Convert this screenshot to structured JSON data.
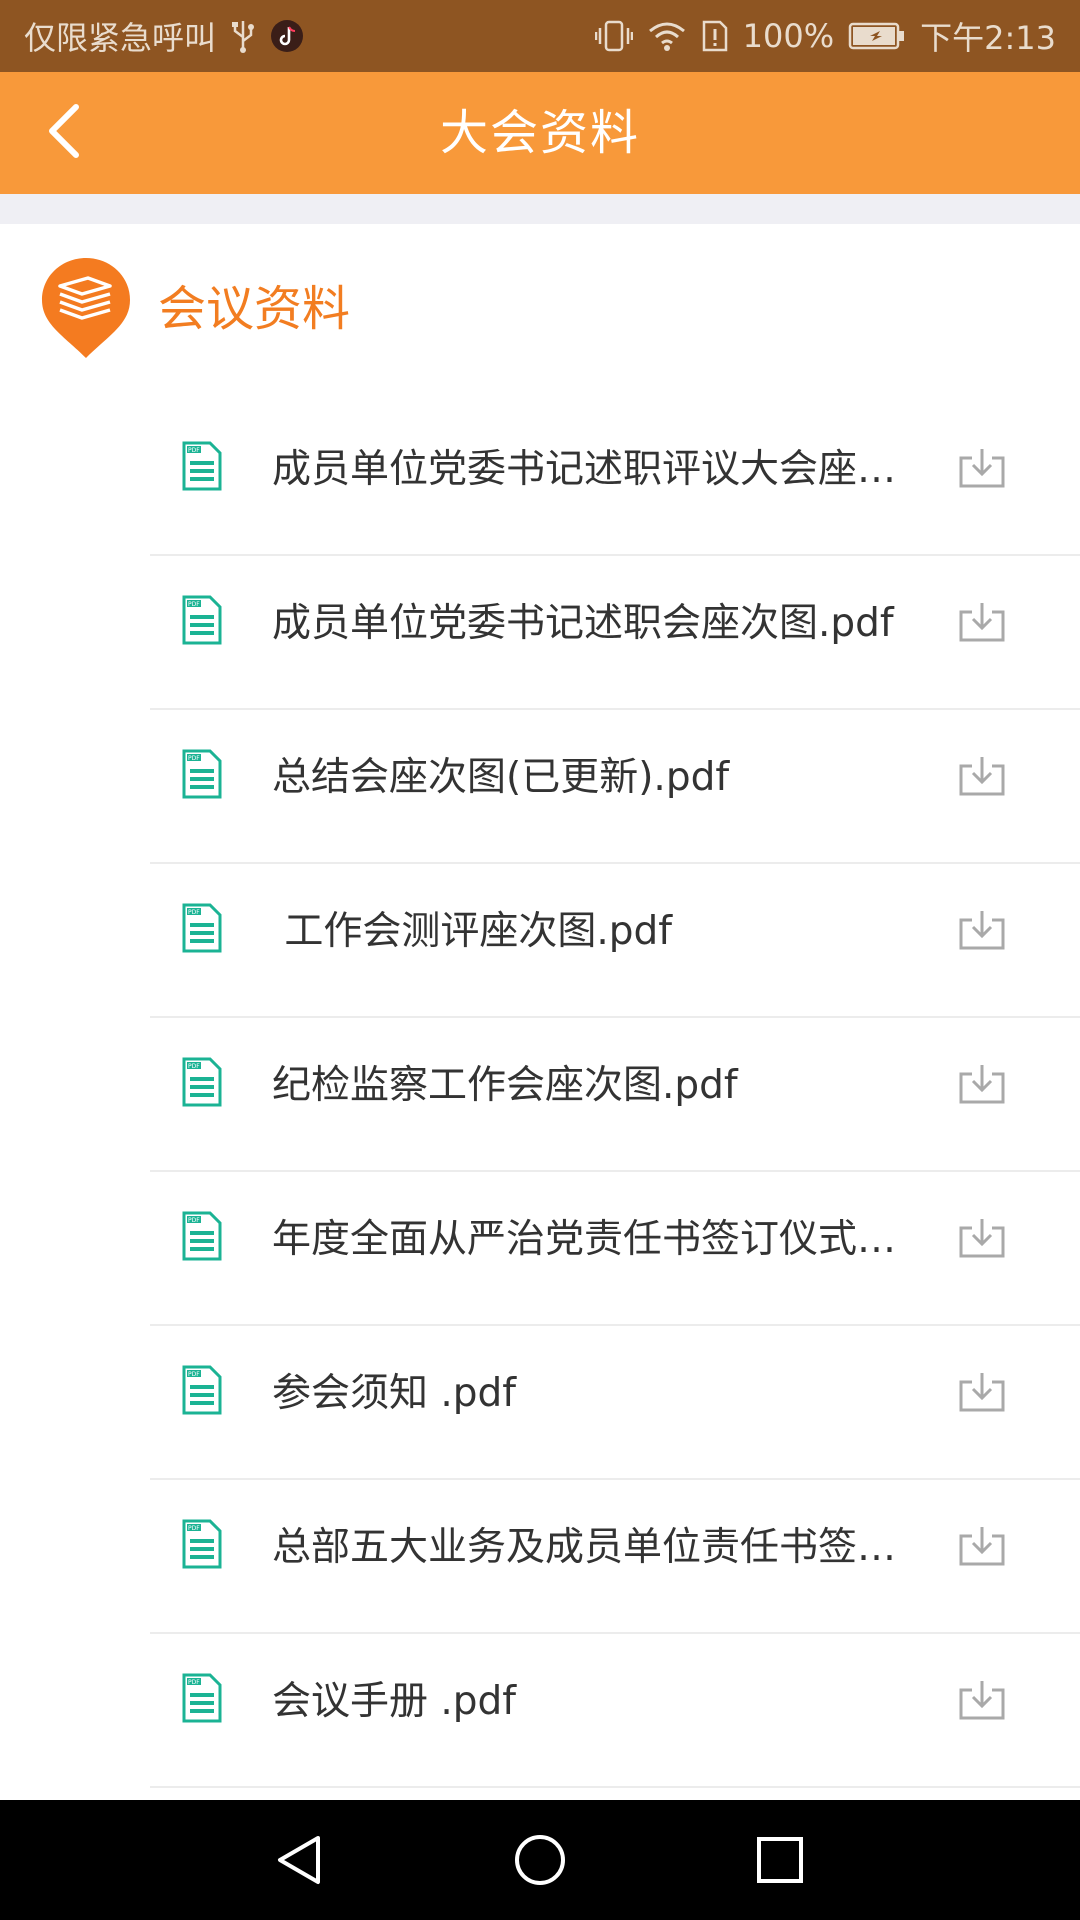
{
  "status_bar": {
    "carrier_text": "仅限紧急呼叫",
    "battery_percent": "100%",
    "time": "下午2:13",
    "icons_left": [
      "usb-icon",
      "tiktok-icon"
    ],
    "icons_right": [
      "vibrate-icon",
      "wifi-icon",
      "sim-alert-icon",
      "battery-icon"
    ]
  },
  "header": {
    "title": "大会资料",
    "back_icon": "chevron-left-icon",
    "background_color": "#f8993a"
  },
  "section": {
    "title": "会议资料",
    "icon": "books-pin-icon",
    "accent_color": "#f27d21"
  },
  "documents": [
    {
      "name": "成员单位党委书记述职评议大会座次图.pdf",
      "icon": "pdf-file-icon",
      "action_icon": "download-icon"
    },
    {
      "name": "成员单位党委书记述职会座次图.pdf",
      "icon": "pdf-file-icon",
      "action_icon": "download-icon"
    },
    {
      "name": "总结会座次图(已更新).pdf",
      "icon": "pdf-file-icon",
      "action_icon": "download-icon"
    },
    {
      "name": " 工作会测评座次图.pdf",
      "icon": "pdf-file-icon",
      "action_icon": "download-icon"
    },
    {
      "name": "纪检监察工作会座次图.pdf",
      "icon": "pdf-file-icon",
      "action_icon": "download-icon"
    },
    {
      "name": "年度全面从严治党责任书签订仪式座次图.pdf",
      "icon": "pdf-file-icon",
      "action_icon": "download-icon"
    },
    {
      "name": "参会须知 .pdf",
      "icon": "pdf-file-icon",
      "action_icon": "download-icon"
    },
    {
      "name": "总部五大业务及成员单位责任书签订仪式座次图.pdf",
      "icon": "pdf-file-icon",
      "action_icon": "download-icon"
    },
    {
      "name": "会议手册 .pdf",
      "icon": "pdf-file-icon",
      "action_icon": "download-icon"
    }
  ],
  "nav_bar": {
    "buttons": [
      "back-triangle-icon",
      "home-circle-icon",
      "recents-square-icon"
    ]
  },
  "colors": {
    "status_bar": "#8e5522",
    "file_icon": "#1bb394",
    "download_icon": "#a9a9a9",
    "divider": "#ececec"
  }
}
